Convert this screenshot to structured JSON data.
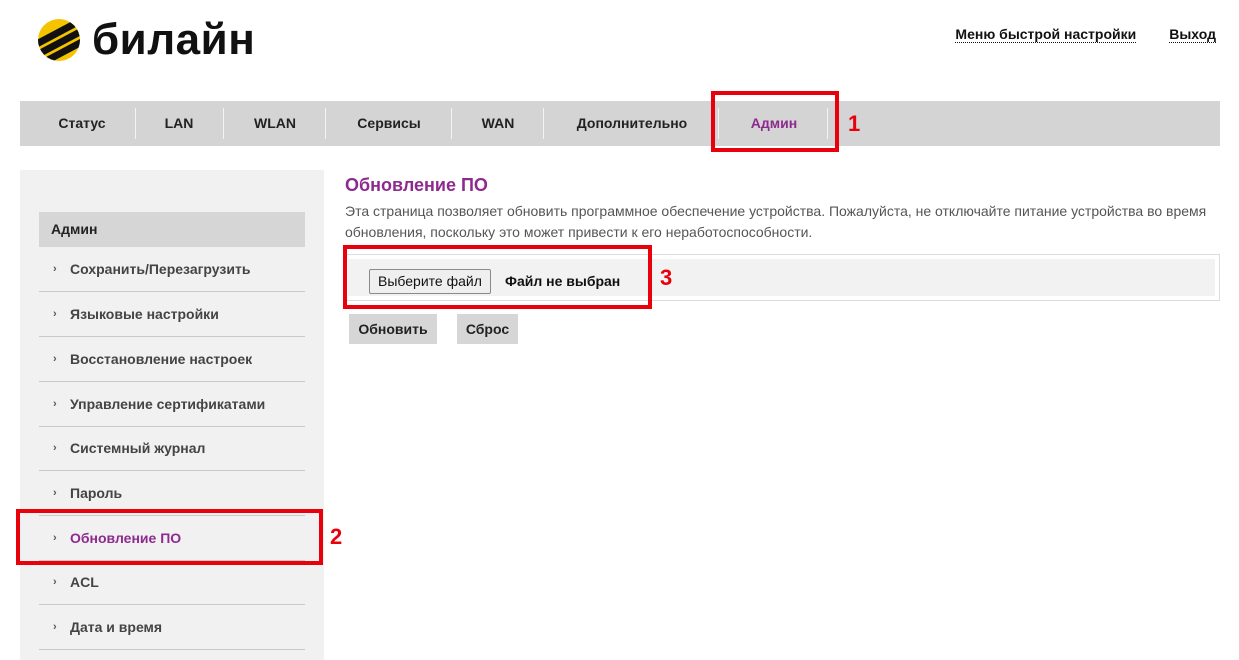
{
  "header": {
    "logo_text": "билайн",
    "links": [
      "Меню быстрой настройки",
      "Выход"
    ]
  },
  "navbar": {
    "items": [
      "Статус",
      "LAN",
      "WLAN",
      "Сервисы",
      "WAN",
      "Дополнительно",
      "Админ"
    ],
    "active": "Админ"
  },
  "sidebar": {
    "heading": "Админ",
    "items": [
      "Сохранить/Перезагрузить",
      "Языковые настройки",
      "Восстановление настроек",
      "Управление сертификатами",
      "Системный журнал",
      "Пароль",
      "Обновление ПО",
      "ACL",
      "Дата и время"
    ],
    "active": "Обновление ПО"
  },
  "content": {
    "title": "Обновление ПО",
    "description": "Эта страница позволяет обновить программное обеспечение устройства. Пожалуйста, не отключайте питание устройства во время обновления, поскольку это может привести к его неработоспособности.",
    "file_button": "Выберите файл",
    "file_status": "Файл не выбран",
    "update_button": "Обновить",
    "reset_button": "Сброс"
  },
  "annotations": [
    "1",
    "2",
    "3"
  ],
  "colors": {
    "accent": "#8e2a8e",
    "annotation": "#e8000b",
    "logo_yellow": "#f5c400"
  }
}
